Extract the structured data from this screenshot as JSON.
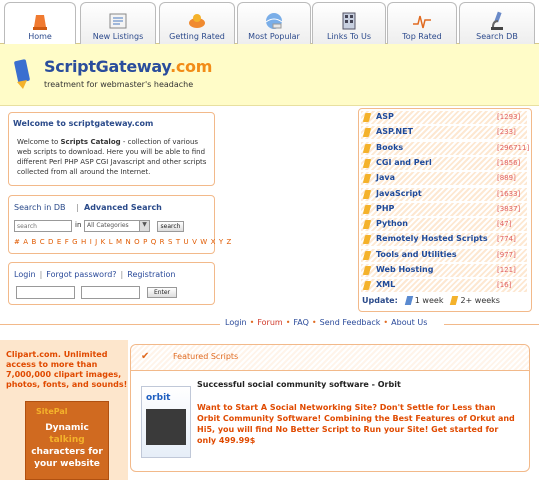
{
  "nav": {
    "tabs": [
      {
        "label": "Home",
        "icon": "bell-icon"
      },
      {
        "label": "New Listings",
        "icon": "listings-icon"
      },
      {
        "label": "Getting Rated",
        "icon": "rating-icon"
      },
      {
        "label": "Most Popular",
        "icon": "popular-icon"
      },
      {
        "label": "Links To Us",
        "icon": "links-icon"
      },
      {
        "label": "Top Rated",
        "icon": "chart-icon"
      },
      {
        "label": "Search DB",
        "icon": "microscope-icon"
      }
    ]
  },
  "banner": {
    "logo_main": "ScriptGateway",
    "logo_domain": ".com",
    "tagline": "treatment for webmaster's headache"
  },
  "welcome": {
    "title": "Welcome to scriptgateway.com",
    "text_before": "Welcome to ",
    "text_strong": "Scripts Catalog",
    "text_after": " - collection of various web scripts to download. Here you will be able to find different Perl PHP ASP CGI Javascript and other scripts collected from all around the Internet."
  },
  "search": {
    "title": "Search in DB",
    "advanced": "Advanced Search",
    "placeholder": "search",
    "in_label": "in",
    "category_selected": "All Categories",
    "button": "search",
    "alphabet": "# A B C D E F G H I J K L M N O P Q R S T U V W X Y Z"
  },
  "login": {
    "login_label": "Login",
    "forgot": "Forgot password?",
    "register": "Registration",
    "enter_button": "Enter"
  },
  "categories": [
    {
      "name": "ASP",
      "count": "[1293]"
    },
    {
      "name": "ASP.NET",
      "count": "[233]"
    },
    {
      "name": "Books",
      "count": "[296711]"
    },
    {
      "name": "CGI and Perl",
      "count": "[1856]"
    },
    {
      "name": "Java",
      "count": "[889]"
    },
    {
      "name": "JavaScript",
      "count": "[1633]"
    },
    {
      "name": "PHP",
      "count": "[3837]"
    },
    {
      "name": "Python",
      "count": "[47]"
    },
    {
      "name": "Remotely Hosted Scripts",
      "count": "[774]"
    },
    {
      "name": "Tools and Utilities",
      "count": "[977]"
    },
    {
      "name": "Web Hosting",
      "count": "[121]"
    },
    {
      "name": "XML",
      "count": "[16]"
    }
  ],
  "update": {
    "label": "Update:",
    "week": "1 week",
    "weeks": "2+ weeks"
  },
  "midnav": {
    "items": [
      "Login",
      "Forum",
      "FAQ",
      "Send Feedback",
      "About Us"
    ]
  },
  "ad": {
    "text": "Clipart.com. Unlimited access to more than 7,000,000 clipart images, photos, fonts, and sounds!",
    "box_head": "SitePal",
    "box_line1": "Dynamic",
    "box_line2": "talking",
    "box_line3": "characters for your website"
  },
  "featured": {
    "title": "Featured Scripts",
    "product_brand": "orbit",
    "product_title": "Successful social community software - Orbit",
    "product_desc": "Want to Start A Social Networking Site? Don't Settle for Less than Orbit Community Software! Combining the Best Features of Orkut and Hi5, you will find No Better Script to Run your Site! Get started for only 499.99$"
  },
  "colors": {
    "accent": "#e06a20",
    "link": "#2a4a9a",
    "banner_bg": "#fffcc8"
  }
}
